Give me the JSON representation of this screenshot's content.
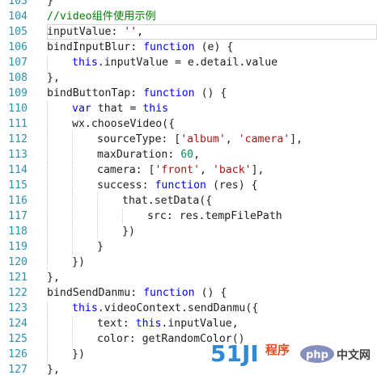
{
  "editor": {
    "colors": {
      "line_number": "#2b91af",
      "comment": "#008000",
      "keyword": "#0000ff",
      "string": "#a31515",
      "number": "#098658",
      "plain": "#1e1e1e"
    },
    "partial_top": {
      "number": "103",
      "indent": 1,
      "tokens": [
        {
          "t": "plain",
          "v": "}"
        }
      ]
    },
    "lines": [
      {
        "number": "104",
        "indent": 1,
        "tokens": [
          {
            "t": "comment",
            "v": "//video组件使用示例"
          }
        ]
      },
      {
        "number": "105",
        "indent": 1,
        "current": true,
        "tokens": [
          {
            "t": "plain",
            "v": "inputValue: "
          },
          {
            "t": "string",
            "v": "''"
          },
          {
            "t": "plain",
            "v": ","
          }
        ]
      },
      {
        "number": "106",
        "indent": 1,
        "tokens": [
          {
            "t": "plain",
            "v": "bindInputBlur: "
          },
          {
            "t": "keyword",
            "v": "function"
          },
          {
            "t": "plain",
            "v": " (e) {"
          }
        ]
      },
      {
        "number": "107",
        "indent": 2,
        "tokens": [
          {
            "t": "keyword",
            "v": "this"
          },
          {
            "t": "plain",
            "v": ".inputValue = e.detail.value"
          }
        ]
      },
      {
        "number": "108",
        "indent": 1,
        "tokens": [
          {
            "t": "plain",
            "v": "},"
          }
        ]
      },
      {
        "number": "109",
        "indent": 1,
        "tokens": [
          {
            "t": "plain",
            "v": "bindButtonTap: "
          },
          {
            "t": "keyword",
            "v": "function"
          },
          {
            "t": "plain",
            "v": " () {"
          }
        ]
      },
      {
        "number": "110",
        "indent": 2,
        "tokens": [
          {
            "t": "keyword",
            "v": "var"
          },
          {
            "t": "plain",
            "v": " that = "
          },
          {
            "t": "keyword",
            "v": "this"
          }
        ]
      },
      {
        "number": "111",
        "indent": 2,
        "tokens": [
          {
            "t": "plain",
            "v": "wx.chooseVideo({"
          }
        ]
      },
      {
        "number": "112",
        "indent": 3,
        "tokens": [
          {
            "t": "plain",
            "v": "sourceType: ["
          },
          {
            "t": "string",
            "v": "'album'"
          },
          {
            "t": "plain",
            "v": ", "
          },
          {
            "t": "string",
            "v": "'camera'"
          },
          {
            "t": "plain",
            "v": "],"
          }
        ]
      },
      {
        "number": "113",
        "indent": 3,
        "tokens": [
          {
            "t": "plain",
            "v": "maxDuration: "
          },
          {
            "t": "number",
            "v": "60"
          },
          {
            "t": "plain",
            "v": ","
          }
        ]
      },
      {
        "number": "114",
        "indent": 3,
        "tokens": [
          {
            "t": "plain",
            "v": "camera: ["
          },
          {
            "t": "string",
            "v": "'front'"
          },
          {
            "t": "plain",
            "v": ", "
          },
          {
            "t": "string",
            "v": "'back'"
          },
          {
            "t": "plain",
            "v": "],"
          }
        ]
      },
      {
        "number": "115",
        "indent": 3,
        "tokens": [
          {
            "t": "plain",
            "v": "success: "
          },
          {
            "t": "keyword",
            "v": "function"
          },
          {
            "t": "plain",
            "v": " (res) {"
          }
        ]
      },
      {
        "number": "116",
        "indent": 4,
        "tokens": [
          {
            "t": "plain",
            "v": "that.setData({"
          }
        ]
      },
      {
        "number": "117",
        "indent": 5,
        "tokens": [
          {
            "t": "plain",
            "v": "src: res.tempFilePath"
          }
        ]
      },
      {
        "number": "118",
        "indent": 4,
        "tokens": [
          {
            "t": "plain",
            "v": "})"
          }
        ]
      },
      {
        "number": "119",
        "indent": 3,
        "tokens": [
          {
            "t": "plain",
            "v": "}"
          }
        ]
      },
      {
        "number": "120",
        "indent": 2,
        "tokens": [
          {
            "t": "plain",
            "v": "})"
          }
        ]
      },
      {
        "number": "121",
        "indent": 1,
        "tokens": [
          {
            "t": "plain",
            "v": "},"
          }
        ]
      },
      {
        "number": "122",
        "indent": 1,
        "tokens": [
          {
            "t": "plain",
            "v": "bindSendDanmu: "
          },
          {
            "t": "keyword",
            "v": "function"
          },
          {
            "t": "plain",
            "v": " () {"
          }
        ]
      },
      {
        "number": "123",
        "indent": 2,
        "tokens": [
          {
            "t": "keyword",
            "v": "this"
          },
          {
            "t": "plain",
            "v": ".videoContext.sendDanmu({"
          }
        ]
      },
      {
        "number": "124",
        "indent": 3,
        "tokens": [
          {
            "t": "plain",
            "v": "text: "
          },
          {
            "t": "keyword",
            "v": "this"
          },
          {
            "t": "plain",
            "v": ".inputValue,"
          }
        ]
      },
      {
        "number": "125",
        "indent": 3,
        "tokens": [
          {
            "t": "plain",
            "v": "color: getRandomColor()"
          }
        ]
      },
      {
        "number": "126",
        "indent": 2,
        "tokens": [
          {
            "t": "plain",
            "v": "})"
          }
        ]
      },
      {
        "number": "127",
        "indent": 1,
        "tokens": [
          {
            "t": "plain",
            "v": "},"
          }
        ]
      }
    ]
  },
  "watermark": {
    "logo_text": "51JI",
    "logo_cn": "程序",
    "site_text": "php",
    "site_cn": "中文网"
  }
}
